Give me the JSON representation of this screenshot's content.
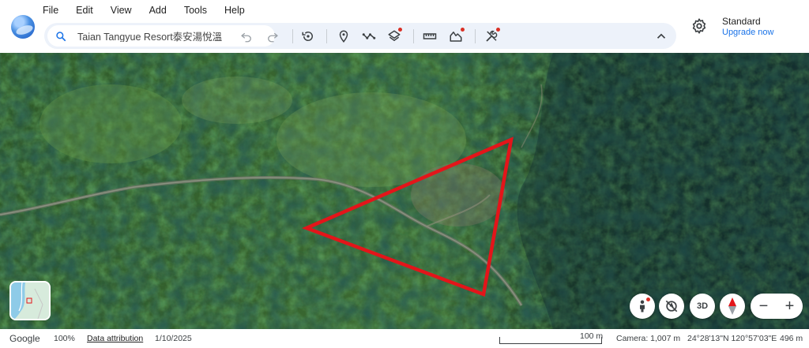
{
  "menu": [
    "File",
    "Edit",
    "View",
    "Add",
    "Tools",
    "Help"
  ],
  "search": {
    "value": "Taian Tangyue Resort泰安湯悅溫"
  },
  "account": {
    "plan": "Standard",
    "upgrade": "Upgrade now"
  },
  "map_controls": {
    "three_d": "3D",
    "zoom_out": "−",
    "zoom_in": "+"
  },
  "status": {
    "brand": "Google",
    "zoom": "100%",
    "attribution": "Data attribution",
    "date": "1/10/2025",
    "scale": "100 m",
    "camera": "Camera: 1,007 m",
    "coords": "24°28'13\"N 120°57'03\"E",
    "elevation": "496 m"
  },
  "colors": {
    "accent": "#1a73e8",
    "annotation": "#e3151a",
    "badge": "#d93025"
  },
  "icons": [
    "search-icon",
    "undo-icon",
    "redo-icon",
    "history-icon",
    "placemark-icon",
    "path-icon",
    "layers-icon",
    "ruler-icon",
    "elevation-icon",
    "tools-icon",
    "collapse-icon",
    "gear-icon",
    "pegman-icon",
    "north-reset-icon",
    "compass-icon"
  ]
}
